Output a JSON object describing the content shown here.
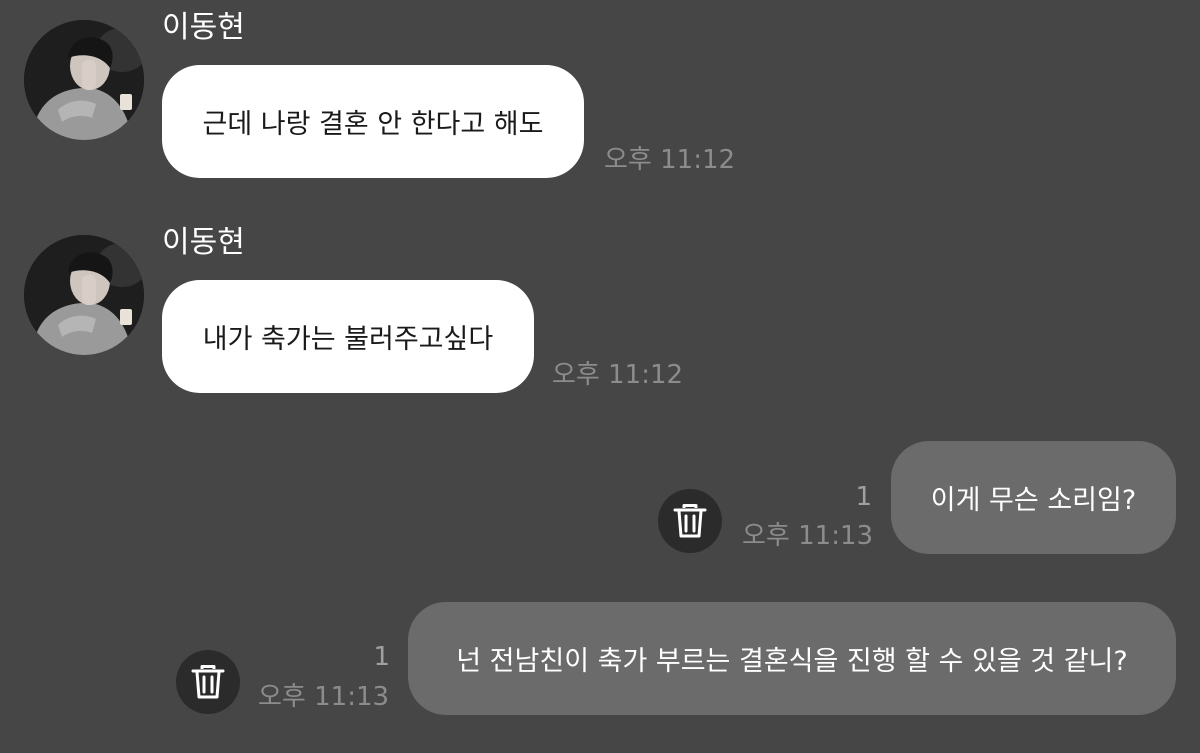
{
  "messages": [
    {
      "direction": "incoming",
      "sender": "이동현",
      "text": "근데 나랑 결혼 안 한다고 해도",
      "time": "오후 11:12"
    },
    {
      "direction": "incoming",
      "sender": "이동현",
      "text": "내가 축가는 불러주고싶다",
      "time": "오후 11:12"
    },
    {
      "direction": "outgoing",
      "text": "이게 무슨 소리임?",
      "time": "오후 11:13",
      "unread_count": "1",
      "action_icon": "trash-icon"
    },
    {
      "direction": "outgoing",
      "text": "넌 전남친이 축가 부르는 결혼식을 진행 할 수 있을 것 같니?",
      "time": "오후 11:13",
      "unread_count": "1",
      "action_icon": "trash-icon"
    }
  ],
  "colors": {
    "background": "#464646",
    "incoming_bubble": "#ffffff",
    "outgoing_bubble": "#6b6b6b",
    "timestamp": "#8c8c8c"
  }
}
